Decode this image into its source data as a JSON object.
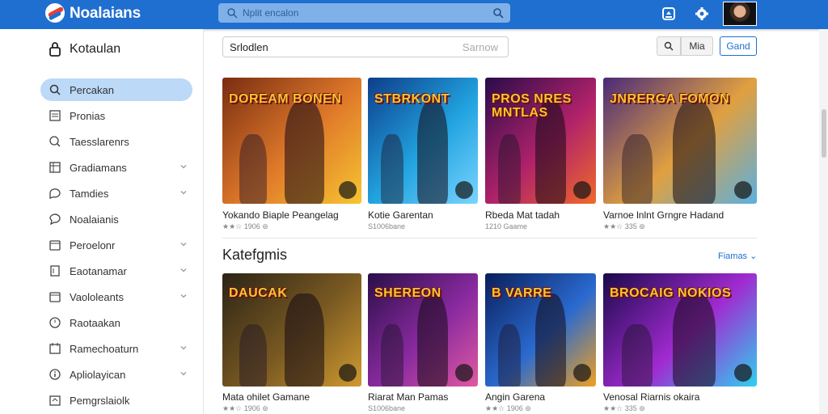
{
  "header": {
    "brand": "Noalaians",
    "search_placeholder": "Nplit encalon"
  },
  "sidebar": {
    "title": "Kotaulan",
    "items": [
      {
        "label": "Percakan",
        "icon": "search-icon",
        "active": true,
        "chevron": false
      },
      {
        "label": "Pronias",
        "icon": "list-icon",
        "active": false,
        "chevron": false
      },
      {
        "label": "Taesslarenrs",
        "icon": "magnifier-icon",
        "active": false,
        "chevron": false
      },
      {
        "label": "Gradiamans",
        "icon": "grid-icon",
        "active": false,
        "chevron": true
      },
      {
        "label": "Tamdies",
        "icon": "chat-icon",
        "active": false,
        "chevron": true
      },
      {
        "label": "Noalaianis",
        "icon": "comment-icon",
        "active": false,
        "chevron": false
      },
      {
        "label": "Peroelonr",
        "icon": "window-icon",
        "active": false,
        "chevron": true
      },
      {
        "label": "Eaotanamar",
        "icon": "doc-icon",
        "active": false,
        "chevron": true
      },
      {
        "label": "Vaololeants",
        "icon": "window-icon",
        "active": false,
        "chevron": true
      },
      {
        "label": "Raotaakan",
        "icon": "clock-icon",
        "active": false,
        "chevron": false
      },
      {
        "label": "Ramechoaturn",
        "icon": "calendar-icon",
        "active": false,
        "chevron": true
      },
      {
        "label": "Apliolayican",
        "icon": "info-icon",
        "active": false,
        "chevron": true
      },
      {
        "label": "Pemgrslaiolk",
        "icon": "package-icon",
        "active": false,
        "chevron": false
      }
    ]
  },
  "main": {
    "search_value": "Srlodlen",
    "search_placeholder": "Sarnow",
    "toolbar_btn_2": "Mia",
    "toolbar_primary": "Gand",
    "section_title": "Katefgmis",
    "section_link": "Fiamas",
    "row1": [
      {
        "art": "DOREAM BONEN",
        "title": "Yokando Biaple Peangelag",
        "sub": "★★☆ 1906 ⊚"
      },
      {
        "art": "STBRKONT",
        "title": "Kotie Garentan",
        "sub": "S1006bane"
      },
      {
        "art": "PROS NRES MNTLAS",
        "title": "Rbeda Mat tadah",
        "sub": "1210 Gaame"
      },
      {
        "art": "JNRERGA FOMON",
        "title": "Varnoe lnlnt Grngre Hadand",
        "sub": "★★☆ 335 ⊚"
      }
    ],
    "row2": [
      {
        "art": "DAUCAK",
        "title": "Mata ohilet Gamane",
        "sub": "★★☆ 1906 ⊚"
      },
      {
        "art": "SHEREON",
        "title": "Riarat Man Pamas",
        "sub": "S1006bane"
      },
      {
        "art": "B VARRE",
        "title": "Angin Garena",
        "sub": "★★☆ 1906 ⊚"
      },
      {
        "art": "BROCAIG NOKIOS",
        "title": "Venosal Riarnis okaira",
        "sub": "★★☆ 335 ⊚"
      }
    ]
  },
  "colors": {
    "accent": "#1f6fd1",
    "sidebar_active": "#bcd9f7"
  }
}
